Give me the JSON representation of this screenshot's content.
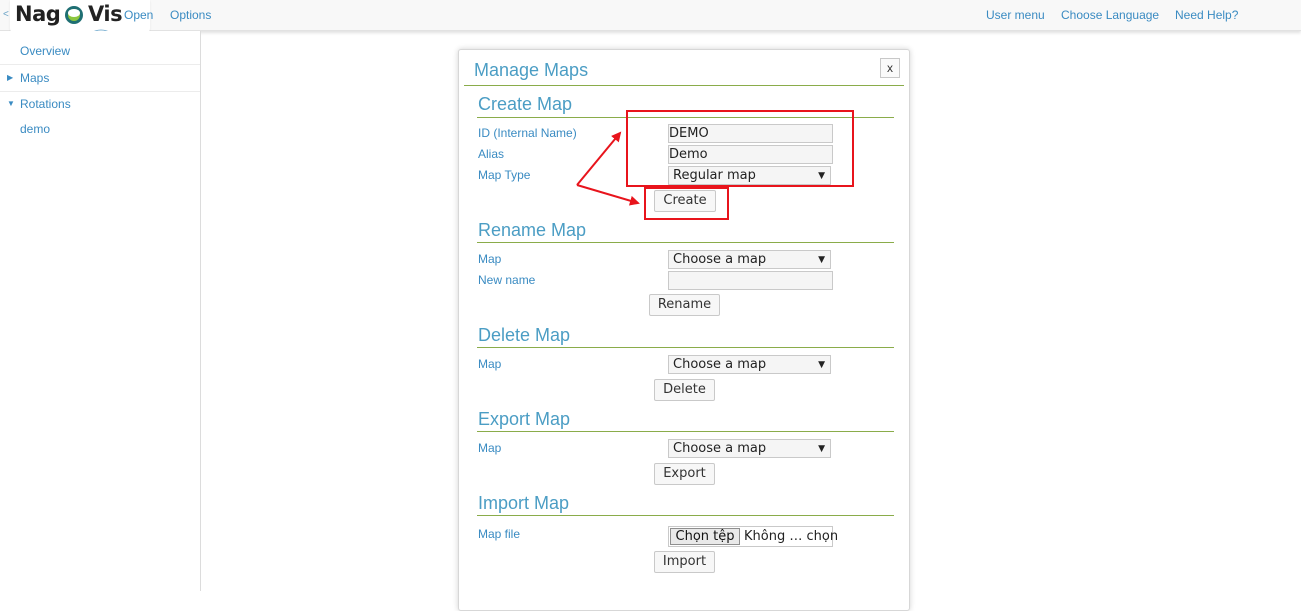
{
  "header": {
    "logo_part1": "Nag",
    "logo_part2": "Vis",
    "nav_left": [
      "Open",
      "Options"
    ],
    "nav_right": [
      "User menu",
      "Choose Language",
      "Need Help?"
    ],
    "collapse_glyph": "<"
  },
  "sidebar": {
    "items": [
      {
        "label": "Overview",
        "icon": ""
      },
      {
        "label": "Maps",
        "icon": "triangle-right"
      },
      {
        "label": "Rotations",
        "icon": "triangle-down"
      },
      {
        "label": "demo",
        "icon": ""
      }
    ]
  },
  "dialog": {
    "title": "Manage Maps",
    "close_label": "x",
    "create": {
      "title": "Create Map",
      "id_label": "ID (Internal Name)",
      "id_value": "DEMO",
      "alias_label": "Alias",
      "alias_value": "Demo",
      "type_label": "Map Type",
      "type_value": "Regular map",
      "button": "Create"
    },
    "rename": {
      "title": "Rename Map",
      "map_label": "Map",
      "map_value": "Choose a map",
      "newname_label": "New name",
      "newname_value": "",
      "button": "Rename"
    },
    "delete": {
      "title": "Delete Map",
      "map_label": "Map",
      "map_value": "Choose a map",
      "button": "Delete"
    },
    "export": {
      "title": "Export Map",
      "map_label": "Map",
      "map_value": "Choose a map",
      "button": "Export"
    },
    "import": {
      "title": "Import Map",
      "file_label": "Map file",
      "file_button": "Chọn tệp",
      "file_status": "Không … chọn",
      "button": "Import"
    }
  },
  "colors": {
    "link": "#3a8bc2",
    "heading": "#4b9dc4",
    "section_rule": "#8aac4a",
    "annotation": "#e8141c"
  }
}
